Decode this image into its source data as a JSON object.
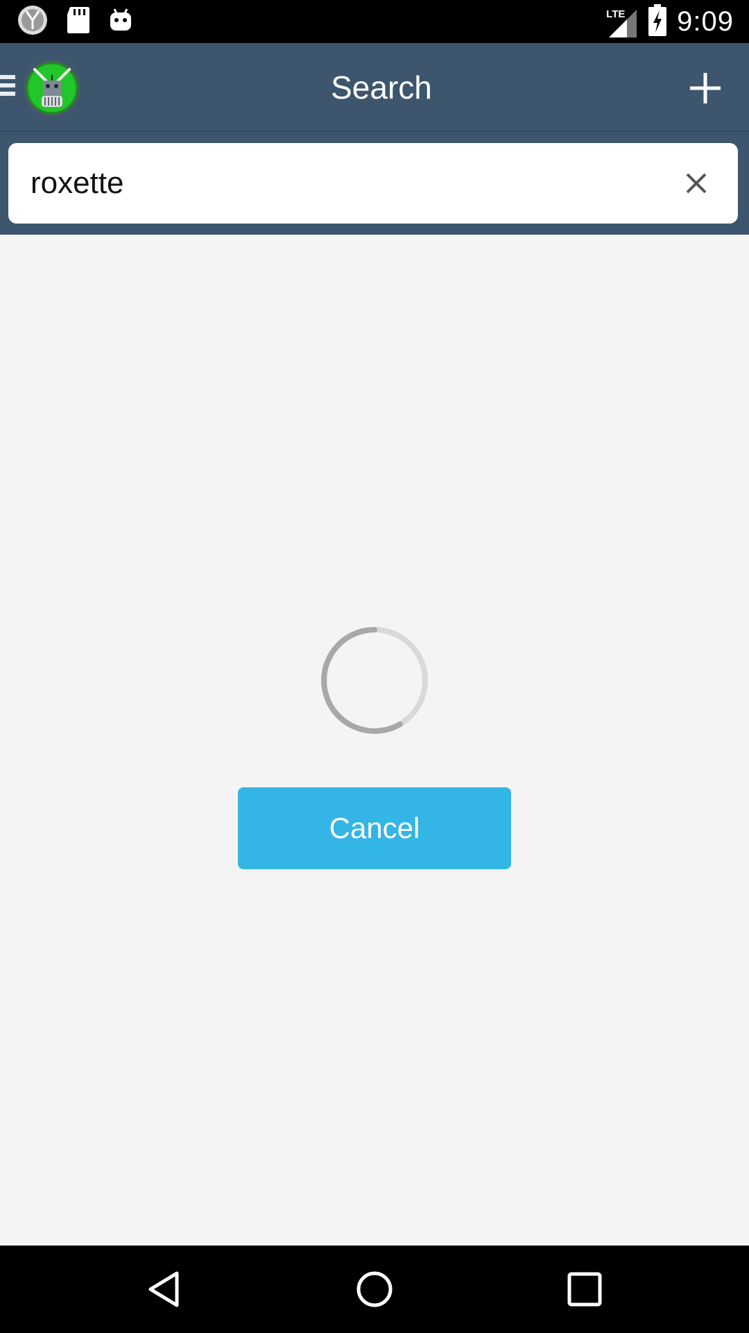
{
  "status_bar": {
    "time": "9:09",
    "network_label": "LTE",
    "icons": [
      "clock-app-icon",
      "sd-card-icon",
      "android-icon",
      "signal-icon",
      "battery-charging-icon"
    ]
  },
  "app_bar": {
    "title": "Search",
    "menu_icon": "hamburger-menu-icon",
    "logo": "app-logo",
    "action_icon": "plus-icon"
  },
  "search": {
    "value": "roxette",
    "clear_icon": "close-icon"
  },
  "content": {
    "loading": true,
    "cancel_label": "Cancel"
  },
  "nav_bar": {
    "icons": [
      "back-icon",
      "home-icon",
      "recents-icon"
    ]
  },
  "colors": {
    "status_bar": "#000000",
    "app_bar": "#3d566e",
    "background": "#f4f4f4",
    "accent": "#33b5e5",
    "search_box": "#ffffff"
  }
}
